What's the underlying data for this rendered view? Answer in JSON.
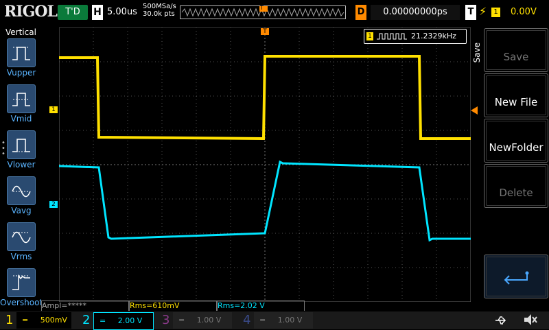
{
  "header": {
    "brand": "RIGOL",
    "run_status": "T'D",
    "horizontal_label": "H",
    "timebase": "5.00us",
    "sample_rate": "500MSa/s",
    "memory_depth": "30.0k pts",
    "trigger_position_marker": "T",
    "delay_label": "D",
    "delay_value": "0.00000000ps",
    "trigger_label": "T",
    "trigger_source": "1",
    "trigger_level": "0.00V"
  },
  "left_panel": {
    "title": "Vertical",
    "items": [
      {
        "label": "Vupper",
        "icon": "vupper-icon"
      },
      {
        "label": "Vmid",
        "icon": "vmid-icon"
      },
      {
        "label": "Vlower",
        "icon": "vlower-icon"
      },
      {
        "label": "Vavg",
        "icon": "vavg-icon"
      },
      {
        "label": "Vrms",
        "icon": "vrms-icon"
      },
      {
        "label": "Overshoot",
        "icon": "overshoot-icon"
      }
    ]
  },
  "screen": {
    "frequency_channel": "1",
    "frequency_value": "21.2329kHz",
    "ch1_marker": "1",
    "ch2_marker": "2",
    "trigger_top_marker": "T"
  },
  "right_panel": {
    "menu_title": "Save",
    "buttons": [
      {
        "label": "Save",
        "enabled": false
      },
      {
        "label": "New File",
        "enabled": true
      },
      {
        "label": "NewFolder",
        "enabled": true
      },
      {
        "label": "Delete",
        "enabled": false
      }
    ],
    "enter_icon": "enter-arrow-icon"
  },
  "measurements": {
    "m1": "Ampl=*****",
    "m2": "Rms=610mV",
    "m3": "Rms=2.02 V"
  },
  "channels": [
    {
      "num": "1",
      "coupling": "=",
      "scale": "500mV",
      "color": "#ffe000",
      "active": true
    },
    {
      "num": "2",
      "coupling": "=",
      "scale": "2.00 V",
      "color": "#00e5ff",
      "active": true
    },
    {
      "num": "3",
      "coupling": "=",
      "scale": "1.00 V",
      "color": "#cc33cc",
      "active": false
    },
    {
      "num": "4",
      "coupling": "=",
      "scale": "1.00 V",
      "color": "#3355ff",
      "active": false
    }
  ],
  "status_icons": [
    "usb-icon",
    "speaker-mute-icon"
  ]
}
